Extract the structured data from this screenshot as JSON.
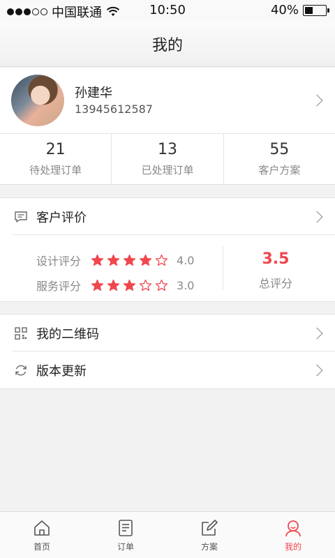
{
  "status_bar": {
    "carrier": "中国联通",
    "time": "10:50",
    "battery_percent": "40%",
    "battery_level": 0.4
  },
  "nav": {
    "title": "我的"
  },
  "profile": {
    "name": "孙建华",
    "phone": "13945612587"
  },
  "stats": [
    {
      "value": "21",
      "label": "待处理订单"
    },
    {
      "value": "13",
      "label": "已处理订单"
    },
    {
      "value": "55",
      "label": "客户方案"
    }
  ],
  "reviews": {
    "title": "客户评价",
    "design": {
      "label": "设计评分",
      "stars": 4,
      "value": "4.0"
    },
    "service": {
      "label": "服务评分",
      "stars": 3,
      "value": "3.0"
    },
    "total_score": "3.5",
    "total_label": "总评分"
  },
  "menu": {
    "qrcode_label": "我的二维码",
    "update_label": "版本更新"
  },
  "tabs": [
    {
      "label": "首页",
      "icon": "home-icon"
    },
    {
      "label": "订单",
      "icon": "order-icon"
    },
    {
      "label": "方案",
      "icon": "edit-icon"
    },
    {
      "label": "我的",
      "icon": "user-icon"
    }
  ],
  "colors": {
    "accent": "#f0474e"
  }
}
